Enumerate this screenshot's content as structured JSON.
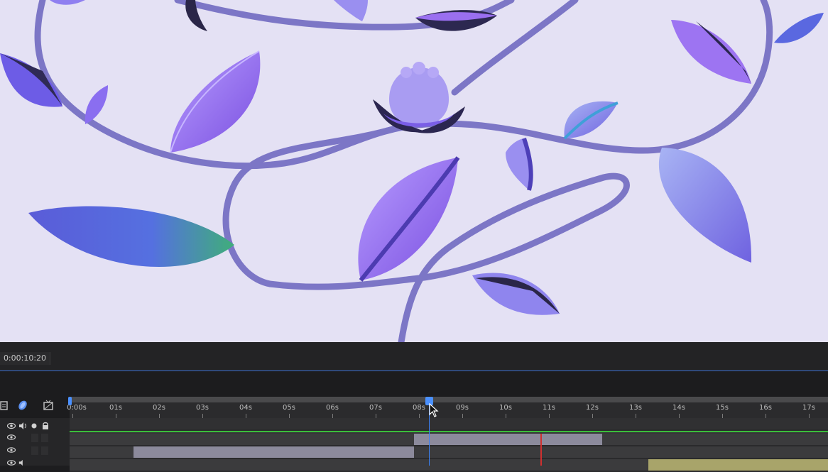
{
  "timecode": "0:00:10:20",
  "ruler_labels": [
    "0:00s",
    "01s",
    "02s",
    "03s",
    "04s",
    "05s",
    "06s",
    "07s",
    "08s",
    "09s",
    "10s",
    "11s",
    "12s",
    "13s",
    "14s",
    "15s",
    "16s",
    "17s"
  ],
  "icons": {
    "comp_flowchart": "flowchart-icon",
    "motion_blur": "motion-blur-icon",
    "frame_blending": "frame-blending-icon",
    "visibility": "eye-icon",
    "audio": "speaker-icon",
    "solo": "solo-dot-icon",
    "lock": "lock-icon"
  },
  "colors": {
    "preview_bg": "#e4e1f4",
    "vine": "#7a74c8",
    "leaf_purple": "#9b6ff0",
    "leaf_blue": "#6a7af0",
    "leaf_dark": "#2a2648",
    "timeline_bg": "#1c1c1e",
    "cti": "#3b82f6",
    "green": "#3bbd3b"
  }
}
